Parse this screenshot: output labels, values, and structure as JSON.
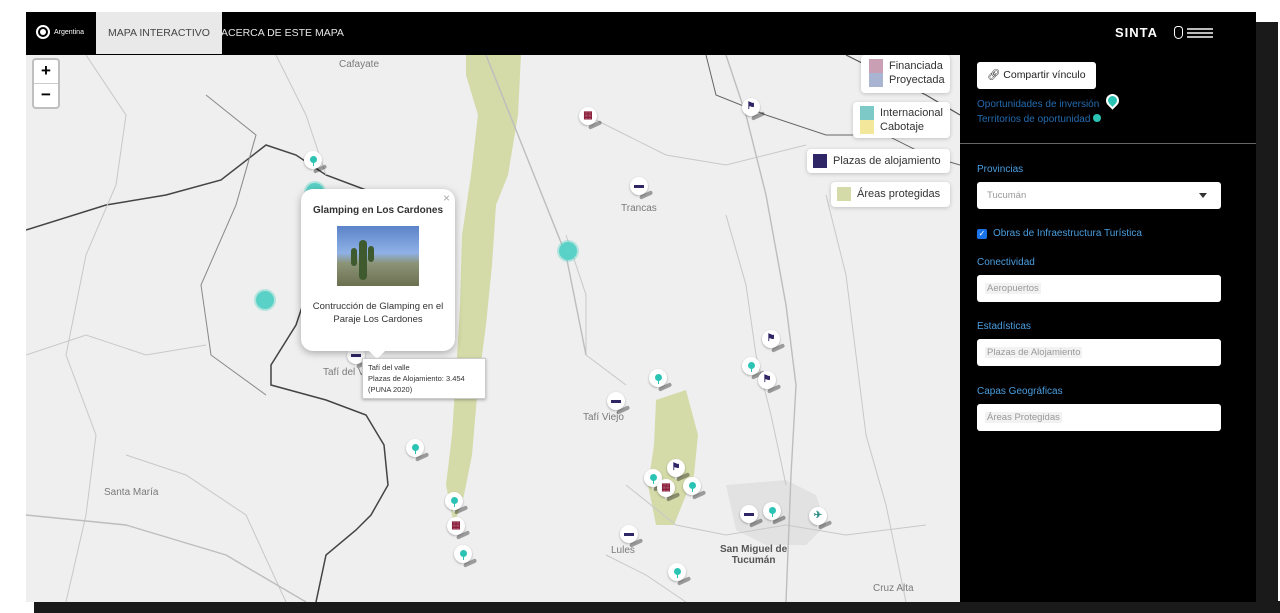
{
  "nav": {
    "brand": "Argentina",
    "tabs": [
      {
        "label": "MAPA INTERACTIVO",
        "active": true
      },
      {
        "label": "ACERCA DE ESTE MAPA",
        "active": false
      }
    ],
    "app_name": "SINTA"
  },
  "map": {
    "zoom_in": "+",
    "zoom_out": "−",
    "place_labels": {
      "cafayate": "Cafayate",
      "tafi_del_valle": "Tafí del Valle",
      "tafi_viejo": "Tafí Viejo",
      "trancas": "Trancas",
      "santa_maria": "Santa María",
      "lules": "Lules",
      "san_miguel": "San Miguel de\nTucumán",
      "cruz_alta": "Cruz Alta"
    },
    "legend": {
      "financiada": "Financiada",
      "proyectada": "Proyectada",
      "internacional": "Internacional",
      "cabotaje": "Cabotaje",
      "plazas": "Plazas de alojamiento",
      "areas": "Áreas protegidas"
    },
    "colors": {
      "financiada": "#c9a0b3",
      "proyectada": "#a9b4d2",
      "internacional": "#7dc9c7",
      "cabotaje": "#f3e79b",
      "plazas": "#2f2665",
      "areas": "#d4dba8",
      "teal": "#2bc4b4",
      "hotel_maroon": "#8b1d3a",
      "bed_navy": "#2f2665"
    },
    "popup": {
      "title": "Glamping en Los Cardones",
      "description": "Contrucción de Glamping en el Paraje Los Cardones",
      "close": "×"
    },
    "tooltip": {
      "line1": "Tafí del valle",
      "line2": "Plazas de Alojamiento: 3.454",
      "line3": "(PUNA 2020)"
    }
  },
  "panel": {
    "share_label": "Compartir vínculo",
    "links": {
      "inversion": "Oportunidades de inversión",
      "territorios": "Territorios de oportunidad"
    },
    "provincias": {
      "title": "Provincias",
      "value": "Tucumán"
    },
    "obras": {
      "label": "Obras de Infraestructura Turística",
      "checked": true
    },
    "conectividad": {
      "title": "Conectividad",
      "value": "Aeropuertos"
    },
    "estadisticas": {
      "title": "Estadísticas",
      "value": "Plazas de Alojamiento"
    },
    "capas": {
      "title": "Capas Geográficas",
      "value": "Áreas Protegidas"
    }
  }
}
